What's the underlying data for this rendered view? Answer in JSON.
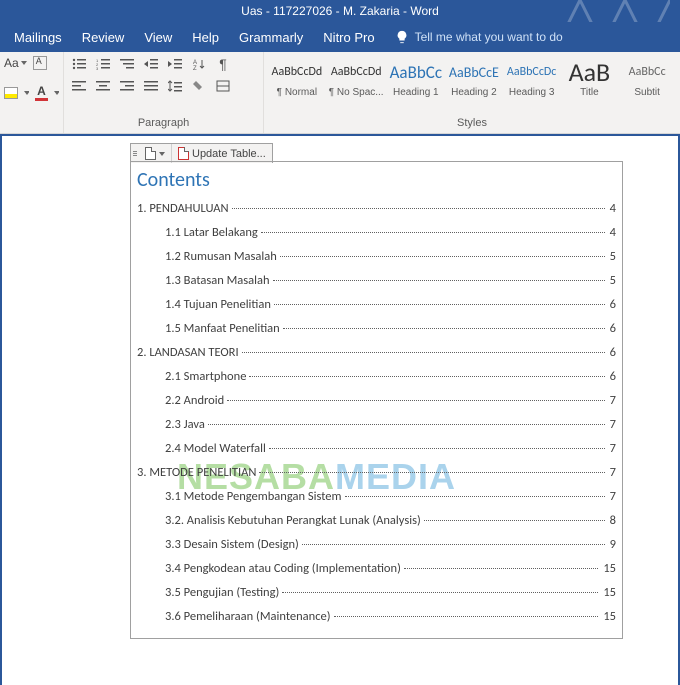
{
  "title": "Uas - 117227026 - M. Zakaria  -  Word",
  "menu": [
    "Mailings",
    "Review",
    "View",
    "Help",
    "Grammarly",
    "Nitro Pro"
  ],
  "tellme": "Tell me what you want to do",
  "groups": {
    "paragraph": "Paragraph",
    "styles": "Styles"
  },
  "styles": [
    {
      "preview": "AaBbCcDd",
      "name": "¶ Normal",
      "size": "12px",
      "color": "#333"
    },
    {
      "preview": "AaBbCcDd",
      "name": "¶ No Spac...",
      "size": "12px",
      "color": "#333"
    },
    {
      "preview": "AaBbCc",
      "name": "Heading 1",
      "size": "17px",
      "color": "#2e74b5"
    },
    {
      "preview": "AaBbCcE",
      "name": "Heading 2",
      "size": "14px",
      "color": "#2e74b5"
    },
    {
      "preview": "AaBbCcDc",
      "name": "Heading 3",
      "size": "12px",
      "color": "#2e74b5"
    },
    {
      "preview": "AaB",
      "name": "Title",
      "size": "26px",
      "color": "#333"
    },
    {
      "preview": "AaBbCc",
      "name": "Subtit",
      "size": "12px",
      "color": "#666"
    }
  ],
  "toc_tab": {
    "update": "Update Table..."
  },
  "toc_title": "Contents",
  "toc": [
    {
      "level": 1,
      "text": "1. PENDAHULUAN",
      "page": "4"
    },
    {
      "level": 2,
      "text": "1.1 Latar Belakang",
      "page": "4"
    },
    {
      "level": 2,
      "text": "1.2 Rumusan Masalah",
      "page": "5"
    },
    {
      "level": 2,
      "text": "1.3 Batasan Masalah",
      "page": "5"
    },
    {
      "level": 2,
      "text": "1.4 Tujuan Penelitian",
      "page": "6"
    },
    {
      "level": 2,
      "text": "1.5 Manfaat Penelitian",
      "page": "6"
    },
    {
      "level": 1,
      "text": "2. LANDASAN TEORI",
      "page": "6"
    },
    {
      "level": 2,
      "text": "2.1 Smartphone",
      "page": "6"
    },
    {
      "level": 2,
      "text": "2.2 Android",
      "page": "7"
    },
    {
      "level": 2,
      "text": "2.3 Java",
      "page": "7"
    },
    {
      "level": 2,
      "text": "2.4 Model Waterfall",
      "page": "7"
    },
    {
      "level": 1,
      "text": "3. METODE PENELITIAN",
      "page": "7"
    },
    {
      "level": 2,
      "text": "3.1 Metode Pengembangan Sistem",
      "page": "7"
    },
    {
      "level": 2,
      "text": "3.2. Analisis Kebutuhan Perangkat Lunak (Analysis)",
      "page": "8"
    },
    {
      "level": 2,
      "text": "3.3 Desain Sistem (Design)",
      "page": "9"
    },
    {
      "level": 2,
      "text": "3.4 Pengkodean atau Coding (Implementation)",
      "page": "15"
    },
    {
      "level": 2,
      "text": "3.5 Pengujian (Testing)",
      "page": "15"
    },
    {
      "level": 2,
      "text": "3.6 Pemeliharaan (Maintenance)",
      "page": "15"
    }
  ],
  "watermark": {
    "part1": "NESABA",
    "part2": "MEDIA"
  }
}
